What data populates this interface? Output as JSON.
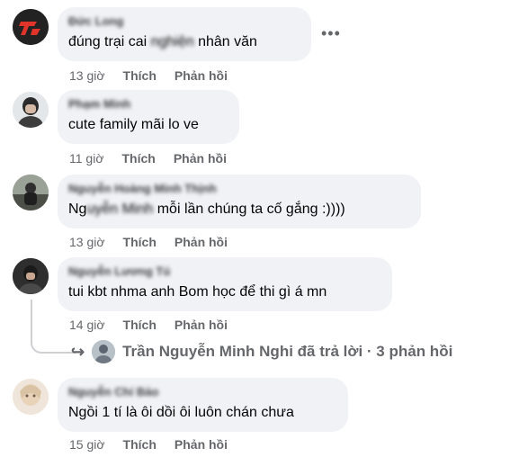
{
  "comments": [
    {
      "author": "Đức Long",
      "text_pre": "đúng trại cai ",
      "text_blur": "nghiện",
      "text_post": " nhân văn",
      "time": "13 giờ",
      "like": "Thích",
      "reply": "Phản hồi"
    },
    {
      "author": "Phạm Minh",
      "text_pre": "cute family mãi lo ve",
      "text_blur": "",
      "text_post": "",
      "time": "11 giờ",
      "like": "Thích",
      "reply": "Phản hồi"
    },
    {
      "author": "Nguyễn Hoàng Minh Thịnh",
      "text_pre": "Ng",
      "text_blur": "uyễn Minh",
      "text_post": " mỗi lần chúng ta cố gắng :))))",
      "time": "13 giờ",
      "like": "Thích",
      "reply": "Phản hồi"
    },
    {
      "author": "Nguyễn Lương Tú",
      "text_pre": "tui kbt nhma anh Bom học để thi gì á mn",
      "text_blur": "",
      "text_post": "",
      "time": "14 giờ",
      "like": "Thích",
      "reply": "Phản hồi"
    },
    {
      "author": "Nguyễn Chí Bảo",
      "text_pre": "Ngồi 1 tí là ôi dồi ôi luôn chán chưa",
      "text_blur": "",
      "text_post": "",
      "time": "15 giờ",
      "like": "Thích",
      "reply": "Phản hồi"
    }
  ],
  "replies_summary": "Trần Nguyễn Minh Nghi đã trả lời · 3 phản hồi",
  "more_label": "•••",
  "colors": {
    "bubble": "#f0f2f5",
    "meta": "#65676b",
    "text": "#050505"
  }
}
